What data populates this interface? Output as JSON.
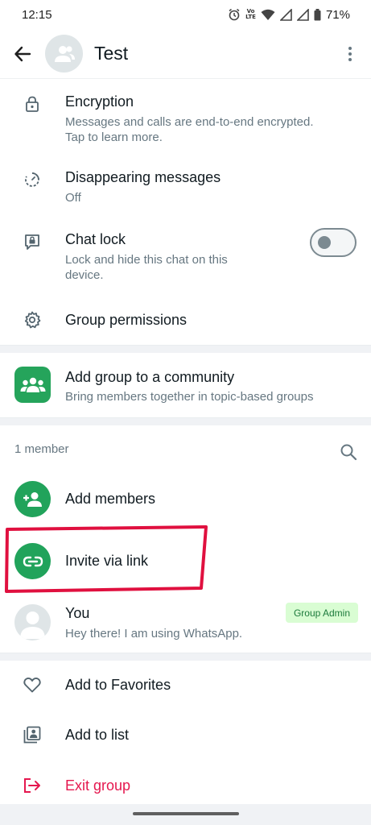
{
  "status_bar": {
    "time": "12:15",
    "volte_top": "Vo",
    "volte_mid": "LTE",
    "battery": "71%"
  },
  "header": {
    "title": "Test"
  },
  "settings": {
    "encryption": {
      "title": "Encryption",
      "subtitle_line1": "Messages and calls are end-to-end encrypted.",
      "subtitle_line2": "Tap to learn more."
    },
    "disappearing": {
      "title": "Disappearing messages",
      "subtitle": "Off"
    },
    "chat_lock": {
      "title": "Chat lock",
      "subtitle_line1": "Lock and hide this chat on this",
      "subtitle_line2": "device.",
      "enabled": false
    },
    "permissions": {
      "title": "Group permissions"
    }
  },
  "community": {
    "title": "Add group to a community",
    "subtitle": "Bring members together in topic-based groups"
  },
  "members": {
    "count_label": "1 member",
    "add_label": "Add members",
    "invite_label": "Invite via link",
    "list": [
      {
        "name": "You",
        "status": "Hey there! I am using WhatsApp.",
        "badge": "Group Admin"
      }
    ]
  },
  "actions": {
    "favorites": "Add to Favorites",
    "add_to_list": "Add to list",
    "exit": "Exit group"
  },
  "colors": {
    "accent_green": "#21a35b",
    "danger_red": "#e5184f",
    "highlight_red": "#e0103f"
  },
  "icons": [
    "back-arrow-icon",
    "group-icon",
    "more-vert-icon",
    "lock-icon",
    "timer-icon",
    "chat-lock-icon",
    "gear-icon",
    "community-icon",
    "search-icon",
    "add-person-icon",
    "link-icon",
    "person-icon",
    "heart-icon",
    "list-icon",
    "exit-icon"
  ]
}
